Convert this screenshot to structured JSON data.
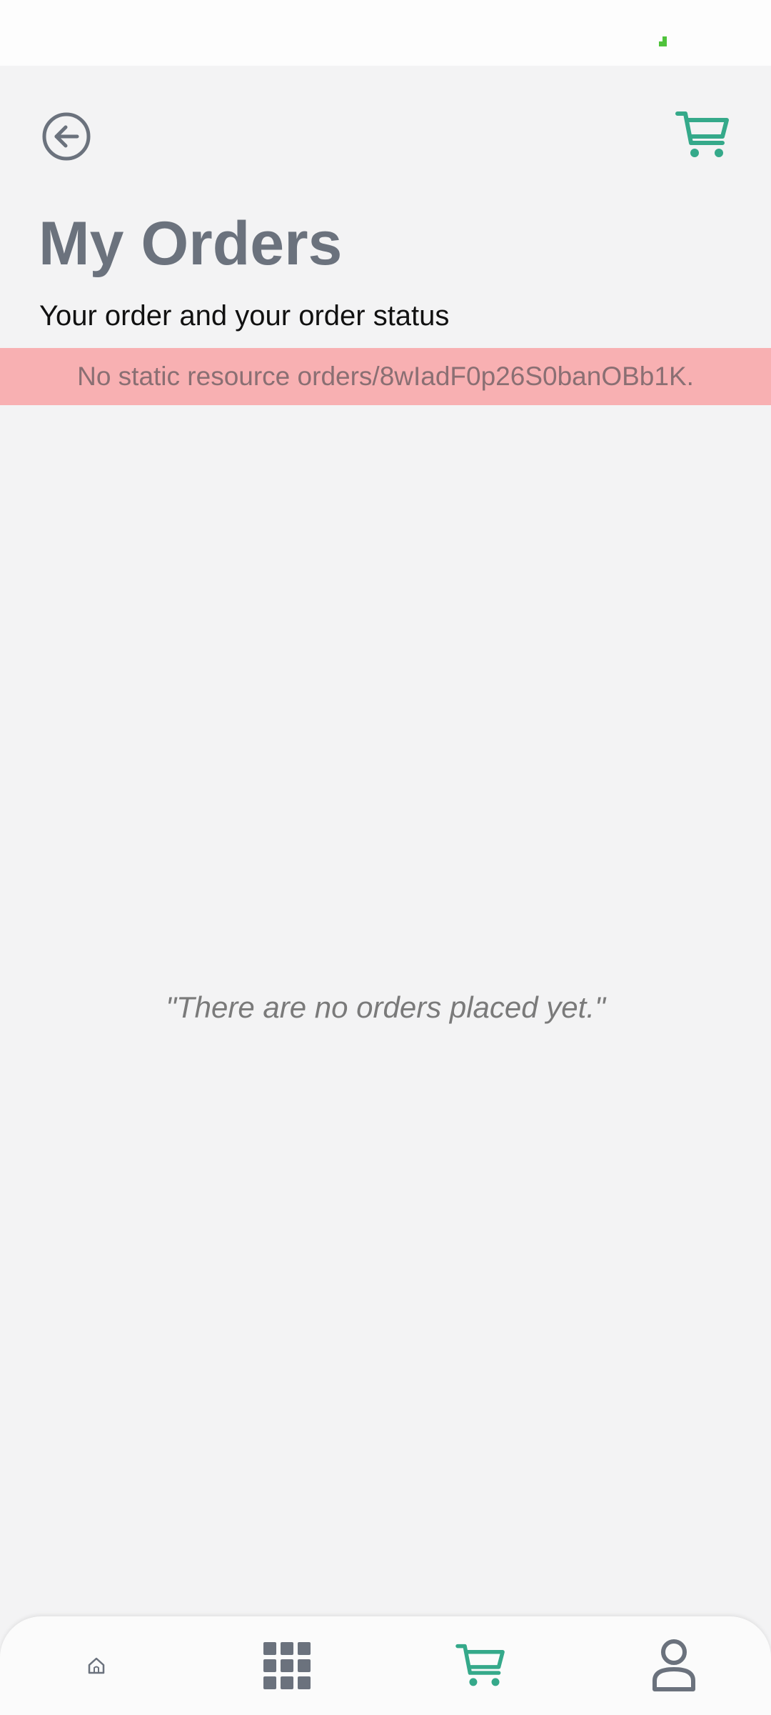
{
  "header": {
    "title": "My Orders",
    "subtitle": "Your order and your order status"
  },
  "error_banner": {
    "text": "No static resource orders/8wIadF0p26S0banOBb1K."
  },
  "empty_state": {
    "message": "\"There are no orders placed yet.\""
  },
  "icons": {
    "back": "arrow-left-circle-icon",
    "header_cart": "cart-icon",
    "nav_home": "home-icon",
    "nav_grid": "grid-icon",
    "nav_cart": "cart-icon",
    "nav_profile": "user-icon"
  },
  "colors": {
    "accent": "#35a98a",
    "title": "#6b727d",
    "error_bg": "#f8b0b2",
    "nav_icon": "#6b727d"
  }
}
